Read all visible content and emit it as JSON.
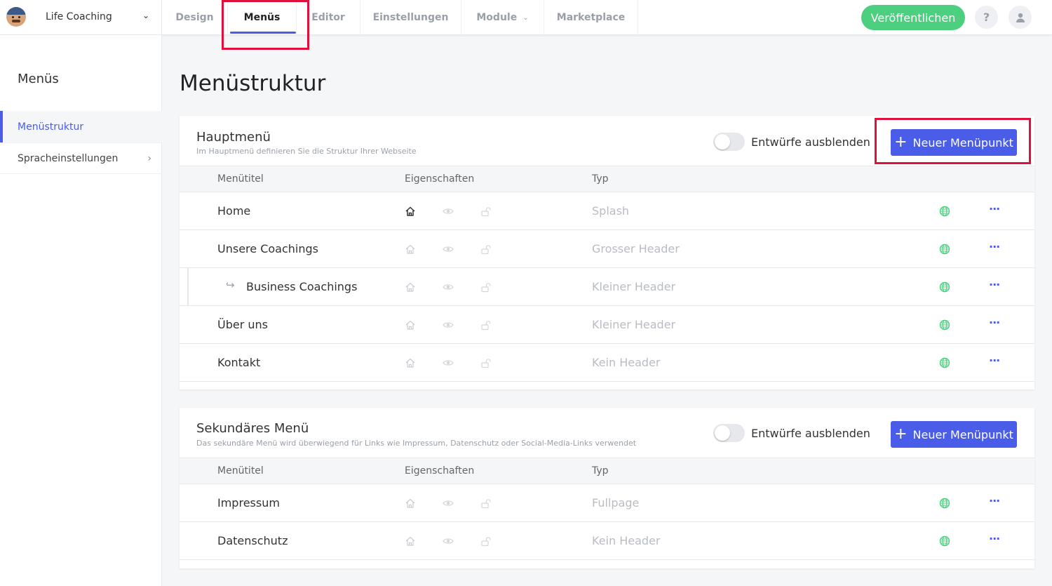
{
  "header": {
    "site_name": "Life Coaching",
    "tabs": [
      {
        "label": "Design"
      },
      {
        "label": "Menüs"
      },
      {
        "label": "Editor"
      },
      {
        "label": "Einstellungen"
      },
      {
        "label": "Module"
      },
      {
        "label": "Marketplace"
      }
    ],
    "active_tab": "Menüs",
    "publish_label": "Veröffentlichen",
    "help_label": "?"
  },
  "sidebar": {
    "title": "Menüs",
    "items": [
      {
        "label": "Menüstruktur",
        "active": true
      },
      {
        "label": "Spracheinstellungen",
        "active": false
      }
    ]
  },
  "page": {
    "title": "Menüstruktur"
  },
  "columns": {
    "title": "Menütitel",
    "props": "Eigenschaften",
    "type": "Typ"
  },
  "menus": [
    {
      "title": "Hauptmenü",
      "description": "Im Hauptmenü definieren Sie die Struktur Ihrer Webseite",
      "toggle_label": "Entwürfe ausblenden",
      "new_label": "Neuer Menüpunkt",
      "rows": [
        {
          "title": "Home",
          "type": "Splash",
          "home_active": true,
          "child": false
        },
        {
          "title": "Unsere Coachings",
          "type": "Grosser Header",
          "home_active": false,
          "child": false
        },
        {
          "title": "Business Coachings",
          "type": "Kleiner Header",
          "home_active": false,
          "child": true
        },
        {
          "title": "Über uns",
          "type": "Kleiner Header",
          "home_active": false,
          "child": false
        },
        {
          "title": "Kontakt",
          "type": "Kein Header",
          "home_active": false,
          "child": false
        }
      ]
    },
    {
      "title": "Sekundäres Menü",
      "description": "Das sekundäre Menü wird überwiegend für Links wie Impressum, Datenschutz oder Social-Media-Links verwendet",
      "toggle_label": "Entwürfe ausblenden",
      "new_label": "Neuer Menüpunkt",
      "rows": [
        {
          "title": "Impressum",
          "type": "Fullpage",
          "home_active": false,
          "child": false
        },
        {
          "title": "Datenschutz",
          "type": "Kein Header",
          "home_active": false,
          "child": false
        }
      ]
    }
  ],
  "colors": {
    "accent": "#4a5de8",
    "publish": "#4ccf7e",
    "highlight": "#e0103c",
    "globe": "#4ccf7e"
  },
  "icons": {
    "row_props": [
      "home-icon",
      "eye-icon",
      "unlock-icon"
    ],
    "row_actions": [
      "globe-icon",
      "more-icon"
    ],
    "child_arrow": "subdirectory-arrow-icon"
  }
}
